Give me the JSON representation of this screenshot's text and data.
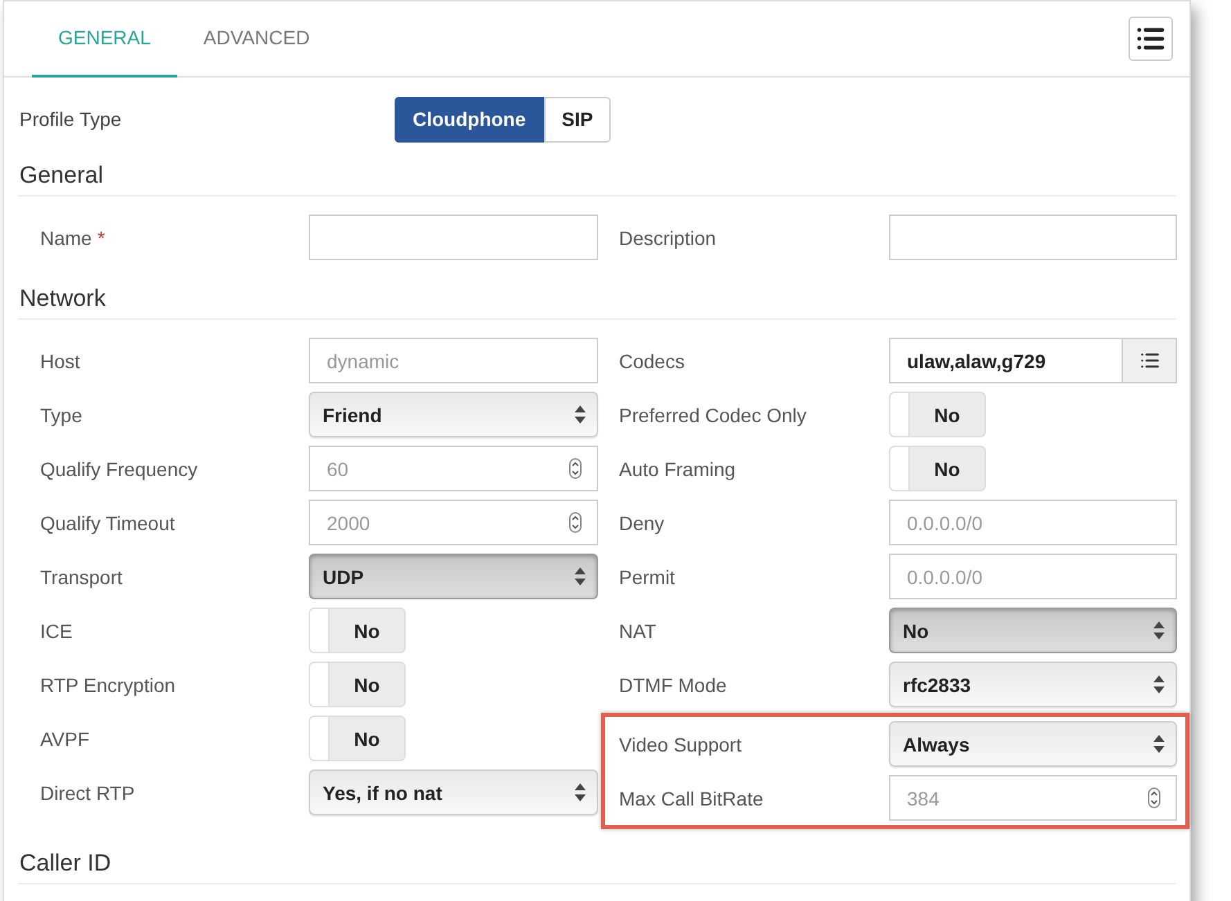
{
  "tabs": [
    {
      "label": "GENERAL",
      "selected": true
    },
    {
      "label": "ADVANCED",
      "selected": false
    }
  ],
  "profile_type": {
    "label": "Profile Type",
    "options": [
      {
        "label": "Cloudphone",
        "selected": true
      },
      {
        "label": "SIP",
        "selected": false
      }
    ]
  },
  "general": {
    "title": "General",
    "left": [
      {
        "kind": "text",
        "label": "Name",
        "required_mark": "*"
      }
    ],
    "right": [
      {
        "kind": "text",
        "label": "Description"
      }
    ]
  },
  "network": {
    "title": "Network",
    "left": [
      {
        "kind": "text",
        "label": "Host",
        "placeholder": "dynamic"
      },
      {
        "kind": "select",
        "label": "Type",
        "value": "Friend",
        "active": false
      },
      {
        "kind": "number",
        "label": "Qualify Frequency",
        "placeholder": "60"
      },
      {
        "kind": "number",
        "label": "Qualify Timeout",
        "placeholder": "2000"
      },
      {
        "kind": "select",
        "label": "Transport",
        "value": "UDP",
        "active": true
      },
      {
        "kind": "toggle",
        "label": "ICE",
        "on": false,
        "state_label": "No"
      },
      {
        "kind": "toggle",
        "label": "RTP Encryption",
        "on": false,
        "state_label": "No"
      },
      {
        "kind": "toggle",
        "label": "AVPF",
        "on": false,
        "state_label": "No"
      },
      {
        "kind": "select",
        "label": "Direct RTP",
        "value": "Yes, if no nat",
        "active": false
      }
    ],
    "right": [
      {
        "kind": "codecs",
        "label": "Codecs",
        "value": "ulaw,alaw,g729"
      },
      {
        "kind": "toggle",
        "label": "Preferred Codec Only",
        "on": false,
        "state_label": "No"
      },
      {
        "kind": "toggle",
        "label": "Auto Framing",
        "on": false,
        "state_label": "No"
      },
      {
        "kind": "text",
        "label": "Deny",
        "placeholder": "0.0.0.0/0"
      },
      {
        "kind": "text",
        "label": "Permit",
        "placeholder": "0.0.0.0/0"
      },
      {
        "kind": "select",
        "label": "NAT",
        "value": "No",
        "active": true
      },
      {
        "kind": "select",
        "label": "DTMF Mode",
        "value": "rfc2833",
        "active": false
      }
    ],
    "highlighted": [
      {
        "kind": "select",
        "label": "Video Support",
        "value": "Always",
        "active": false
      },
      {
        "kind": "number",
        "label": "Max Call BitRate",
        "placeholder": "384"
      }
    ]
  },
  "caller_id": {
    "title": "Caller ID"
  }
}
